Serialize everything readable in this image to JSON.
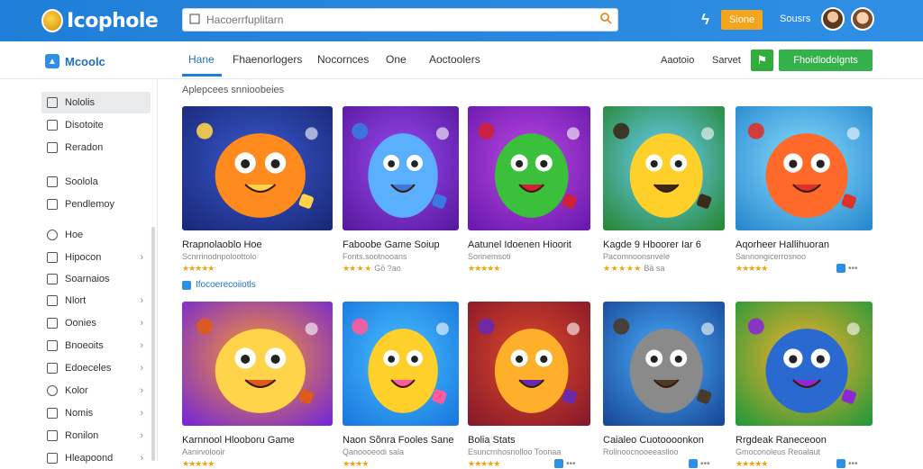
{
  "topbar": {
    "logo_text": "Icophole",
    "search_placeholder": "Hacoerrfuplitarn",
    "flash_glyph": "ϟ",
    "button_label": "Sione",
    "link_label": "Sousrs"
  },
  "subnav": {
    "brand_text": "Mcoolc",
    "tabs": [
      "Hane",
      "Fhaenorlogers",
      "Nocornces",
      "One",
      "Aoctoolers"
    ],
    "link1": "Aaotoio",
    "link2": "Sarvet",
    "green_button": "Fhoidlodolgnts"
  },
  "sidebar": {
    "items": [
      {
        "label": "Nololis",
        "chevron": false
      },
      {
        "label": "Disotoite",
        "chevron": false
      },
      {
        "label": "Reradon",
        "chevron": false
      },
      {
        "label": "Soolola",
        "chevron": false
      },
      {
        "label": "Pendlemoy",
        "chevron": false
      },
      {
        "label": "Hoe",
        "chevron": false
      },
      {
        "label": "Hipocon",
        "chevron": true
      },
      {
        "label": "Soarnaios",
        "chevron": false
      },
      {
        "label": "Nlort",
        "chevron": true
      },
      {
        "label": "Oonies",
        "chevron": true
      },
      {
        "label": "Bnoeoits",
        "chevron": true
      },
      {
        "label": "Edoeceles",
        "chevron": true
      },
      {
        "label": "Kolor",
        "chevron": true
      },
      {
        "label": "Nomis",
        "chevron": true
      },
      {
        "label": "Ronilon",
        "chevron": true
      },
      {
        "label": "Hleapoond",
        "chevron": true
      }
    ]
  },
  "main": {
    "section_title": "Aplepcees snnioobeies",
    "link_line": "Ifocoerecoiiotls",
    "row1": [
      {
        "title": "Rrapnolaoblo Hoe",
        "sub": "Scnrrinodnpoloottolo",
        "stars": "★★★★★",
        "count": ""
      },
      {
        "title": "Faboobe Game Soiup",
        "sub": "Fonts.sootnooans",
        "stars": "★★ ★ ★",
        "count": "Gō ?ao"
      },
      {
        "title": "Aatunel Idoenen Hioorit",
        "sub": "Sorinemsoti",
        "stars": "★★★★★",
        "count": ""
      },
      {
        "title": "Kagde 9 Hboorer Iar 6",
        "sub": "Pacomnoonsnvele",
        "stars": "★ ★ ★ ★ ★",
        "count": "Bā sa"
      },
      {
        "title": "Aqorheer Hallihuoran",
        "sub": "Sannongicerrosnoo",
        "stars": "★★★★★",
        "count": "•••"
      }
    ],
    "row2": [
      {
        "title": "Karnnool Hlooboru Game",
        "sub": "Aanirvolooir",
        "stars": "★★★★★",
        "count": ""
      },
      {
        "title": "Naon Sõnra Fooles Sane",
        "sub": "Qanoooeodi sala",
        "stars": "★★★★",
        "count": ""
      },
      {
        "title": "Bolia Stats",
        "sub": "Esuncrnhosnolloo Toonaa",
        "stars": "★★★★★",
        "count": "•••"
      },
      {
        "title": "Caialeo Cuotoooonkon",
        "sub": "Rolinoocnooeeaslloo",
        "stars": "",
        "count": "•••"
      },
      {
        "title": "Rrgdeak Raneceoon",
        "sub": "Gmoconoleus Reoalaut",
        "stars": "★★★★★",
        "count": "•••"
      }
    ]
  }
}
